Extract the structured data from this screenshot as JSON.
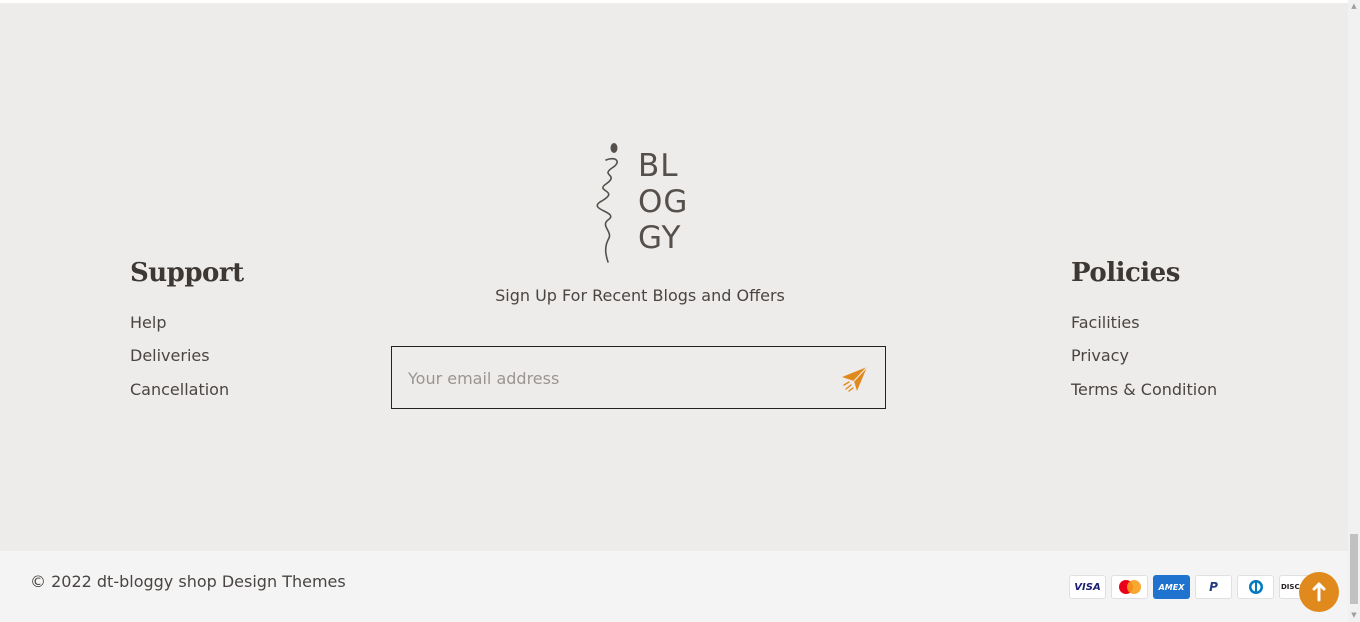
{
  "support": {
    "title": "Support",
    "links": [
      "Help",
      "Deliveries",
      "Cancellation"
    ]
  },
  "policies": {
    "title": "Policies",
    "links": [
      "Facilities",
      "Privacy",
      "Terms & Condition"
    ]
  },
  "logo": {
    "lines": [
      "BL",
      "OG",
      "GY"
    ]
  },
  "newsletter": {
    "heading": "Sign Up For Recent Blogs and Offers",
    "placeholder": "Your email address",
    "send_icon": "paper-plane-icon"
  },
  "bottom": {
    "copyright": "© 2022 dt-bloggy shop Design Themes",
    "payments": [
      {
        "name": "visa-icon",
        "label": "VISA"
      },
      {
        "name": "mastercard-icon",
        "label": ""
      },
      {
        "name": "amex-icon",
        "label": "AMEX"
      },
      {
        "name": "paypal-icon",
        "label": "P"
      },
      {
        "name": "diners-icon",
        "label": ""
      },
      {
        "name": "discover-icon",
        "label": "DISCOV"
      }
    ]
  },
  "colors": {
    "accent": "#e0891d",
    "footer_bg": "#eeecea",
    "bottom_bg": "#f4f4f4"
  }
}
